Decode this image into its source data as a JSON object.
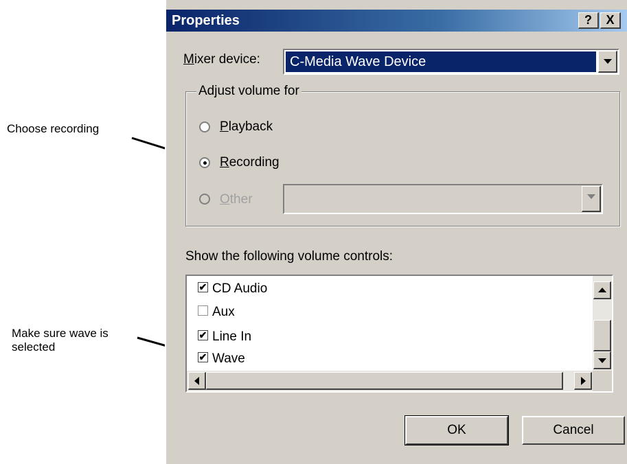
{
  "annotations": {
    "choose_recording": "Choose recording",
    "make_sure_wave": "Make sure wave is selected"
  },
  "dialog": {
    "title": "Properties",
    "help_label": "?",
    "close_label": "X",
    "mixer_label": "Mixer device:",
    "mixer_value": "C-Media Wave Device",
    "group_title": "Adjust volume for",
    "options": {
      "playback": "Playback",
      "recording": "Recording",
      "other": "Other",
      "selected": "Recording"
    },
    "other_value": "",
    "controls_label": "Show the following volume controls:",
    "controls": [
      {
        "label": "CD Audio",
        "checked": true
      },
      {
        "label": "Aux",
        "checked": false
      },
      {
        "label": "Line In",
        "checked": true
      },
      {
        "label": "Wave",
        "checked": true
      }
    ],
    "ok_label": "OK",
    "cancel_label": "Cancel"
  },
  "colors": {
    "titlebar_start": "#0a246a",
    "titlebar_end": "#a6caf0",
    "selection": "#0a246a",
    "dialog_bg": "#d4d0c8"
  }
}
